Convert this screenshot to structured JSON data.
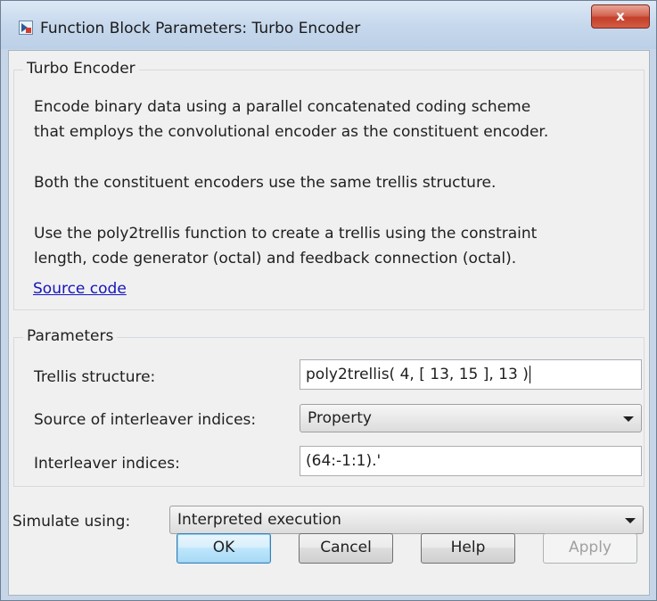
{
  "window": {
    "title": "Function Block Parameters: Turbo Encoder",
    "close_label": "x"
  },
  "description": {
    "group_title": "Turbo Encoder",
    "lines": [
      "Encode binary data using a parallel concatenated coding scheme",
      "that employs the convolutional encoder as the constituent encoder.",
      "Both the constituent encoders use the same trellis structure.",
      "Use the poly2trellis function to create a trellis using the constraint",
      "length, code generator (octal) and feedback connection (octal)."
    ],
    "link": "Source code"
  },
  "parameters": {
    "group_title": "Parameters",
    "trellis_label": "Trellis structure:",
    "trellis_value": "poly2trellis( 4, [ 13, 15 ], 13 )",
    "source_label": "Source of interleaver indices:",
    "source_value": "Property",
    "indices_label": "Interleaver indices:",
    "indices_value": "(64:-1:1).'"
  },
  "simulate": {
    "label": "Simulate using:",
    "value": "Interpreted execution"
  },
  "buttons": {
    "ok": "OK",
    "cancel": "Cancel",
    "help": "Help",
    "apply": "Apply"
  },
  "icons": {
    "app": "simulink-block-icon",
    "dropdown": "chevron-down-icon"
  }
}
